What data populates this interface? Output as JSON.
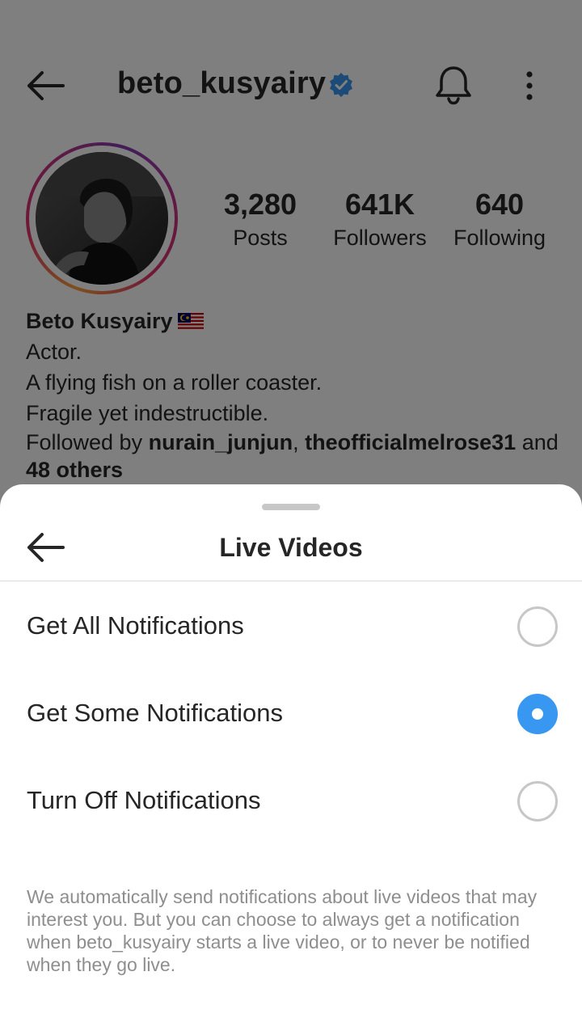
{
  "profile": {
    "username": "beto_kusyairy",
    "stats": {
      "posts": {
        "value": "3,280",
        "label": "Posts"
      },
      "followers": {
        "value": "641K",
        "label": "Followers"
      },
      "following": {
        "value": "640",
        "label": "Following"
      }
    },
    "bio": {
      "name": "Beto Kusyairy",
      "lines": [
        "Actor.",
        "A flying fish on a roller coaster.",
        "Fragile yet indestructible."
      ],
      "followed_by_prefix": "Followed by ",
      "followed_by_users": [
        "nurain_junjun",
        "theofficialmelrose31"
      ],
      "followed_by_sep": ", ",
      "followed_by_and": " and ",
      "followed_by_others": "48 others"
    }
  },
  "sheet": {
    "title": "Live Videos",
    "options": [
      {
        "label": "Get All Notifications",
        "selected": false
      },
      {
        "label": "Get Some Notifications",
        "selected": true
      },
      {
        "label": "Turn Off Notifications",
        "selected": false
      }
    ],
    "description": "We automatically send notifications about live videos that may interest you. But you can choose to always get a notification when beto_kusyairy starts a live video, or to never be notified when they go live."
  },
  "colors": {
    "accent": "#3897f0",
    "verified": "#3897f0",
    "text": "#262626",
    "muted": "#8e8e8e"
  },
  "icons": [
    "back-arrow-icon",
    "verified-badge-icon",
    "bell-icon",
    "more-vertical-icon",
    "malaysia-flag-icon"
  ]
}
